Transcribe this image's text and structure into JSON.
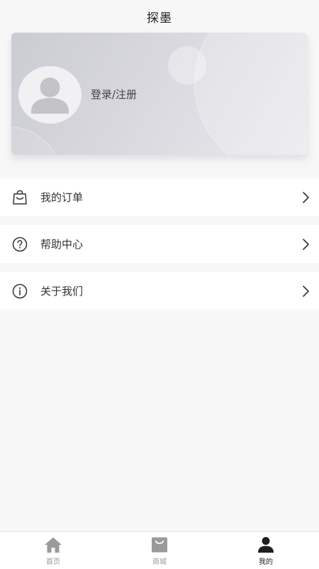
{
  "header": {
    "title": "探墨"
  },
  "profile": {
    "login_label": "登录/注册"
  },
  "menu": [
    {
      "label": "我的订单",
      "icon": "shopping-bag-icon"
    },
    {
      "label": "帮助中心",
      "icon": "question-circle-icon"
    },
    {
      "label": "关于我们",
      "icon": "info-circle-icon"
    }
  ],
  "tabbar": [
    {
      "label": "首页",
      "icon": "home-icon",
      "active": false
    },
    {
      "label": "商城",
      "icon": "shop-bag-icon",
      "active": false
    },
    {
      "label": "我的",
      "icon": "user-icon",
      "active": true
    }
  ],
  "colors": {
    "background": "#f7f7f7",
    "card_gradient_start": "#cbcbd3",
    "card_gradient_end": "#e9e9ee",
    "active_tab": "#222222",
    "inactive_tab": "#999999"
  }
}
